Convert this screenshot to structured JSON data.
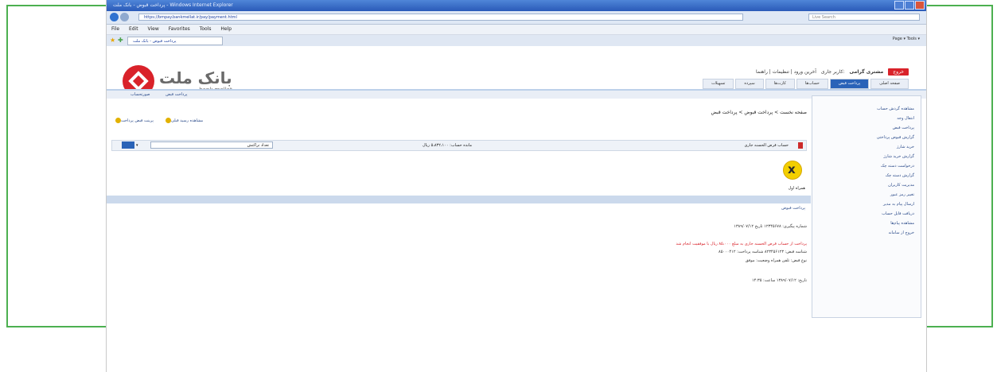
{
  "window": {
    "title": "پرداخت قبوض - بانک ملت - Windows Internet Explorer"
  },
  "address": {
    "url": "https://bmpay.bankmellat.ir/pay/payment.html",
    "search_placeholder": "Live Search"
  },
  "menu": [
    "File",
    "Edit",
    "View",
    "Favorites",
    "Tools",
    "Help"
  ],
  "favbar": {
    "tab_title": "پرداخت قبوض - بانک ملت",
    "tools_text": "Page ▾  Tools ▾"
  },
  "bank": {
    "name_fa": "بانک ملت",
    "name_en": "bank mellat"
  },
  "user_bar": {
    "user_label": "کاربر جاری:",
    "user_name": "مشتری گرامی",
    "links": "آخرین ورود | تنظیمات | راهنما",
    "exit": "خروج"
  },
  "top_nav": [
    "صفحه اصلی",
    "پرداخت قبض",
    "حساب‌ها",
    "کارت‌ها",
    "سپرده",
    "تسهیلات"
  ],
  "quick_links": [
    "پرداخت قبض",
    "صورتحساب"
  ],
  "breadcrumb": "صفحه نخست > پرداخت قبوض > پرداخت قبض",
  "actions": [
    "پرینت قبض پرداخت",
    "مشاهده رسید قبلی"
  ],
  "account_row": {
    "account_text": "حساب قرض الحسنه جاری",
    "balance_text": "مانده حساب: ۵،۸۳۲،۱۰۰ ریال",
    "filter_text": "تعداد تراکنش",
    "go_label": "ok"
  },
  "bill": {
    "caption": "همراه اول",
    "section": "پرداخت قبوض"
  },
  "details": {
    "line1": "شماره پیگیری: ۱۲۳۴۵۶۷۸  تاریخ ۱۳۸۹/۰۷/۱۲",
    "line2": "پرداخت از حساب قرض الحسنه جاری به مبلغ ۸۵،۰۰۰ ریال با موفقیت انجام شد",
    "line3": "شناسه قبض: ۸۲۳۴۵۶۱۲۳   شناسه پرداخت: ۸۵۰۰۰۴۱۲",
    "line4": "نوع قبض: تلفن همراه  وضعیت: موفق",
    "line5": "تاریخ: ۱۳۸۹/۰۷/۱۲  ساعت: ۱۴:۳۵"
  },
  "sidebar": [
    "مشاهده گردش حساب",
    "انتقال وجه",
    "پرداخت قبض",
    "گزارش قبوض پرداختی",
    "خرید شارژ",
    "گزارش خرید شارژ",
    "درخواست دسته چک",
    "گزارش دسته چک",
    "مدیریت کاربران",
    "تغییر رمز عبور",
    "ارسال پیام به مدیر",
    "دریافت فایل حساب",
    "مشاهده پیام‌ها",
    "خروج از سامانه"
  ],
  "colors": {
    "frame_green": "#4cb050",
    "accent_blue": "#2a63b8",
    "exit_red": "#d9222a"
  }
}
